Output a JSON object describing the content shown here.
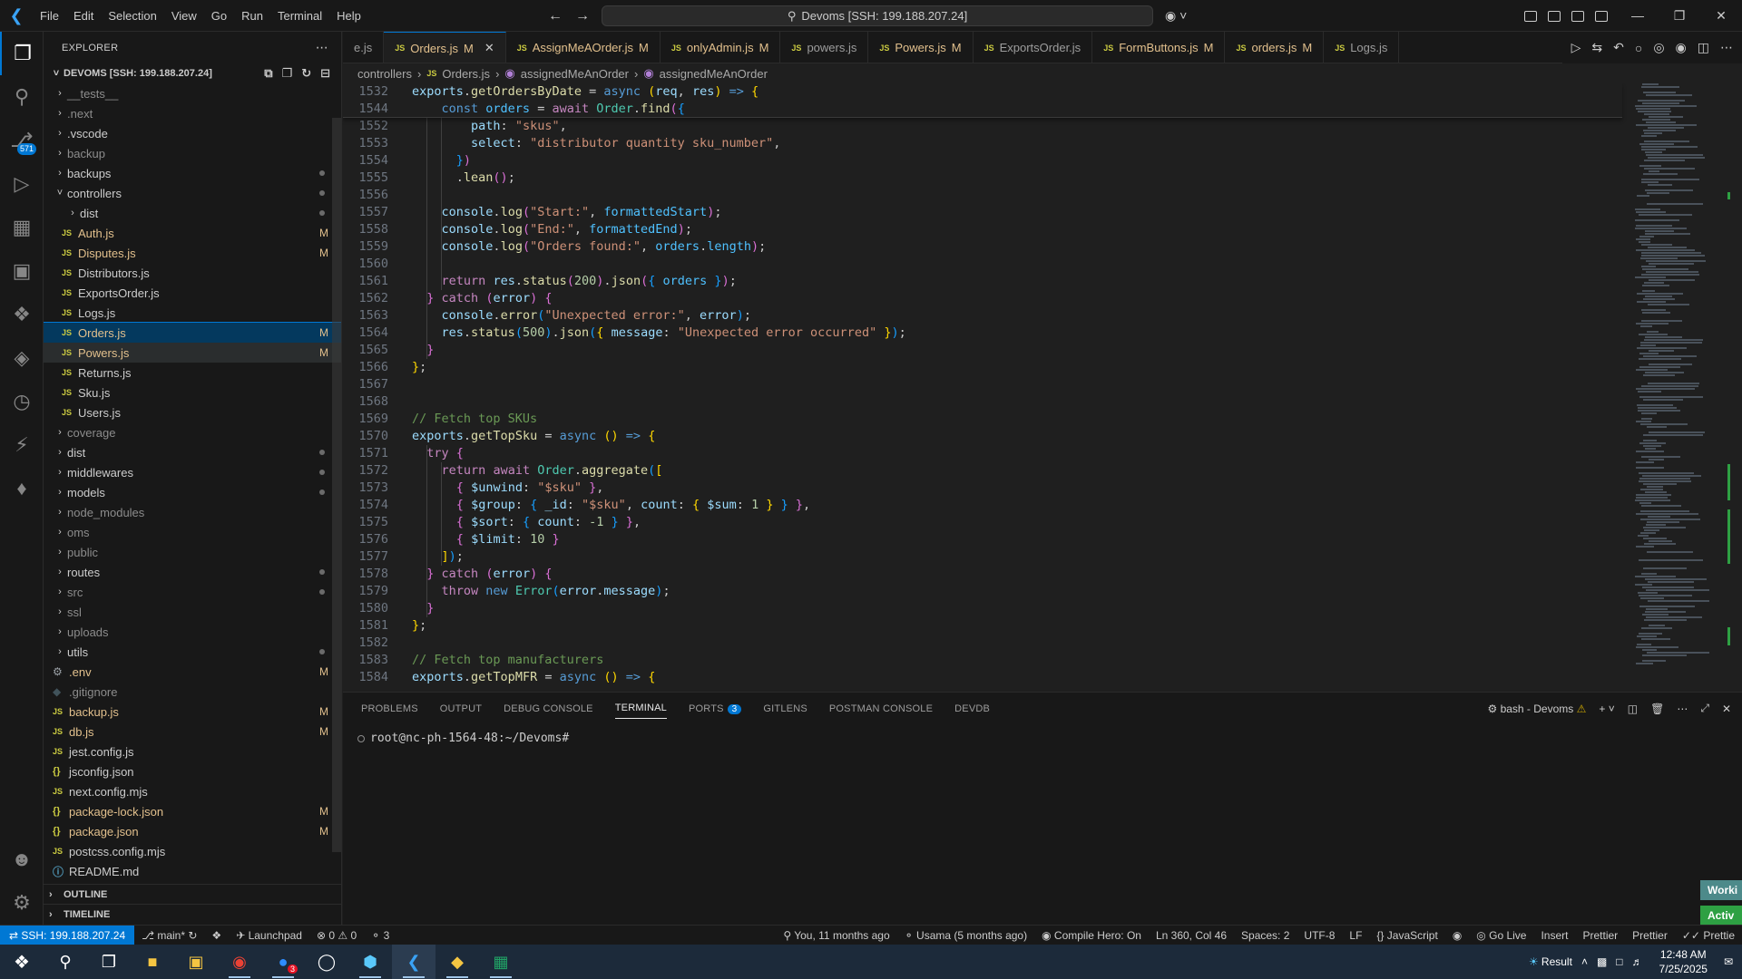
{
  "titlebar": {
    "menu": [
      "File",
      "Edit",
      "Selection",
      "View",
      "Go",
      "Run",
      "Terminal",
      "Help"
    ],
    "search": "Devoms [SSH: 199.188.207.24]"
  },
  "activity_badges": {
    "scm": "571"
  },
  "explorer": {
    "title": "EXPLORER",
    "root": "DEVOMS [SSH: 199.188.207.24]",
    "items": [
      {
        "name": "__tests__",
        "type": "folder",
        "indent": 1
      },
      {
        "name": ".next",
        "type": "folder",
        "indent": 1
      },
      {
        "name": ".vscode",
        "type": "folder",
        "indent": 1
      },
      {
        "name": "backup",
        "type": "folder",
        "indent": 1
      },
      {
        "name": "backups",
        "type": "folder",
        "indent": 1
      },
      {
        "name": "controllers",
        "type": "folder-open",
        "indent": 1
      },
      {
        "name": "dist",
        "type": "folder",
        "indent": 2
      },
      {
        "name": "Auth.js",
        "type": "js",
        "indent": 2,
        "status": "M"
      },
      {
        "name": "Disputes.js",
        "type": "js",
        "indent": 2,
        "status": "M"
      },
      {
        "name": "Distributors.js",
        "type": "js",
        "indent": 2
      },
      {
        "name": "ExportsOrder.js",
        "type": "js",
        "indent": 2
      },
      {
        "name": "Logs.js",
        "type": "js",
        "indent": 2
      },
      {
        "name": "Orders.js",
        "type": "js",
        "indent": 2,
        "status": "M"
      },
      {
        "name": "Powers.js",
        "type": "js",
        "indent": 2,
        "status": "M"
      },
      {
        "name": "Returns.js",
        "type": "js",
        "indent": 2
      },
      {
        "name": "Sku.js",
        "type": "js",
        "indent": 2
      },
      {
        "name": "Users.js",
        "type": "js",
        "indent": 2
      },
      {
        "name": "coverage",
        "type": "folder",
        "indent": 1
      },
      {
        "name": "dist",
        "type": "folder",
        "indent": 1
      },
      {
        "name": "middlewares",
        "type": "folder",
        "indent": 1
      },
      {
        "name": "models",
        "type": "folder",
        "indent": 1
      },
      {
        "name": "node_modules",
        "type": "folder",
        "indent": 1
      },
      {
        "name": "oms",
        "type": "folder",
        "indent": 1
      },
      {
        "name": "public",
        "type": "folder",
        "indent": 1
      },
      {
        "name": "routes",
        "type": "folder",
        "indent": 1
      },
      {
        "name": "src",
        "type": "folder",
        "indent": 1
      },
      {
        "name": "ssl",
        "type": "folder",
        "indent": 1
      },
      {
        "name": "uploads",
        "type": "folder",
        "indent": 1
      },
      {
        "name": "utils",
        "type": "folder",
        "indent": 1
      },
      {
        "name": ".env",
        "type": "gear",
        "indent": 1,
        "status": "M"
      },
      {
        "name": ".gitignore",
        "type": "git",
        "indent": 1
      },
      {
        "name": "backup.js",
        "type": "js",
        "indent": 1,
        "status": "M"
      },
      {
        "name": "db.js",
        "type": "js",
        "indent": 1,
        "status": "M"
      },
      {
        "name": "jest.config.js",
        "type": "js",
        "indent": 1
      },
      {
        "name": "jsconfig.json",
        "type": "json",
        "indent": 1
      },
      {
        "name": "next.config.mjs",
        "type": "js",
        "indent": 1
      },
      {
        "name": "package-lock.json",
        "type": "json",
        "indent": 1,
        "status": "M"
      },
      {
        "name": "package.json",
        "type": "json",
        "indent": 1,
        "status": "M"
      },
      {
        "name": "postcss.config.mjs",
        "type": "js",
        "indent": 1
      },
      {
        "name": "README.md",
        "type": "info",
        "indent": 1
      }
    ],
    "outline": "OUTLINE",
    "timeline": "TIMELINE"
  },
  "tabs": [
    {
      "label": "e.js",
      "status": "",
      "js": false
    },
    {
      "label": "Orders.js",
      "status": "M",
      "js": true,
      "active": true
    },
    {
      "label": "AssignMeAOrder.js",
      "status": "M",
      "js": true
    },
    {
      "label": "onlyAdmin.js",
      "status": "M",
      "js": true
    },
    {
      "label": "powers.js",
      "status": "",
      "js": true
    },
    {
      "label": "Powers.js",
      "status": "M",
      "js": true
    },
    {
      "label": "ExportsOrder.js",
      "status": "",
      "js": true
    },
    {
      "label": "FormButtons.js",
      "status": "M",
      "js": true
    },
    {
      "label": "orders.js",
      "status": "M",
      "js": true
    },
    {
      "label": "Logs.js",
      "status": "",
      "js": true
    }
  ],
  "breadcrumb": {
    "folder": "controllers",
    "file": "Orders.js",
    "sym1": "assignedMeAnOrder",
    "sym2": "assignedMeAnOrder"
  },
  "panel": {
    "tabs": [
      "PROBLEMS",
      "OUTPUT",
      "DEBUG CONSOLE",
      "TERMINAL",
      "PORTS",
      "GITLENS",
      "POSTMAN CONSOLE",
      "DEVDB"
    ],
    "ports_badge": "3",
    "shell": "bash - Devoms",
    "prompt": "root@nc-ph-1564-48:~/Devoms#",
    "badge_work": "Worki",
    "badge_active": "Activ"
  },
  "statusbar": {
    "remote": "SSH: 199.188.207.24",
    "branch": "main*",
    "launchpad": "Launchpad",
    "errors": "0",
    "warnings": "0",
    "ports": "3",
    "blame": "You, 11 months ago",
    "author": "Usama (5 months ago)",
    "compile": "Compile Hero: On",
    "position": "Ln 360, Col 46",
    "spaces": "Spaces: 2",
    "encoding": "UTF-8",
    "eol": "LF",
    "language": "JavaScript",
    "golive": "Go Live",
    "insert": "Insert",
    "prettier1": "Prettier",
    "prettier2": "Prettier",
    "prettier3": "Prettie"
  },
  "taskbar": {
    "weather": "Result",
    "time": "12:48 AM",
    "date": "7/25/2025",
    "zoom_badge": "3"
  }
}
